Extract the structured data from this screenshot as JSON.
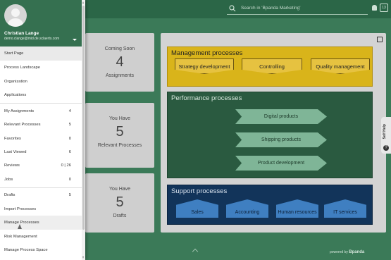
{
  "topbar": {
    "search_placeholder": "Search in 'Bpanda Marketing'",
    "badge": "13"
  },
  "cards": [
    {
      "kicker": "Coming Soon",
      "value": "4",
      "label": "Assignments"
    },
    {
      "kicker": "You Have",
      "value": "5",
      "label": "Relevant Processes"
    },
    {
      "kicker": "You Have",
      "value": "5",
      "label": "Drafts"
    }
  ],
  "landscape": {
    "management": {
      "title": "Management processes",
      "items": [
        "Strategy development",
        "Controlling",
        "Quality management"
      ]
    },
    "performance": {
      "title": "Performance processes",
      "items": [
        "Digital products",
        "Shipping products",
        "Product development"
      ]
    },
    "support": {
      "title": "Support processes",
      "items": [
        "Sales",
        "Accounting",
        "Human resources",
        "IT services"
      ]
    }
  },
  "self_help": "Self Help",
  "footer": {
    "powered_by": "powered by",
    "brand": "Bpanda"
  },
  "drawer": {
    "user": {
      "name": "Christian Lange",
      "email": "demo.clange@mid.de.sclaerts.com"
    },
    "group1": [
      "Start Page",
      "Process Landscape",
      "Organization",
      "Applications"
    ],
    "group2": [
      {
        "label": "My Assignments",
        "count": "4"
      },
      {
        "label": "Relevant Processes",
        "count": "5"
      },
      {
        "label": "Favorites",
        "count": "0"
      },
      {
        "label": "Last Viewed",
        "count": "6"
      },
      {
        "label": "Reviews",
        "count": "0 | 26"
      },
      {
        "label": "Jobs",
        "count": "0"
      }
    ],
    "group3": [
      {
        "label": "Drafts",
        "count": "5"
      },
      {
        "label": "Import Processes",
        "count": ""
      },
      {
        "label": "Manage Processes",
        "count": ""
      },
      {
        "label": "Risk Management",
        "count": ""
      },
      {
        "label": "Manage Process Space",
        "count": ""
      }
    ]
  }
}
